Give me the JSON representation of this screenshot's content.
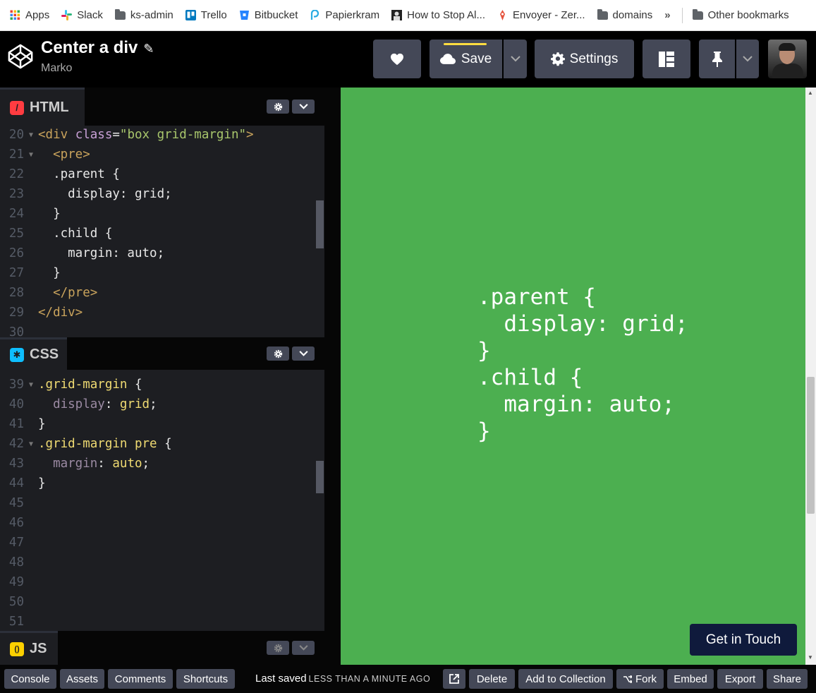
{
  "bookmarks": [
    {
      "label": "Apps",
      "icon": "apps-grid-icon",
      "color": "#ea4335"
    },
    {
      "label": "Slack",
      "icon": "slack-icon",
      "color": "#e01e5a"
    },
    {
      "label": "ks-admin",
      "icon": "folder-icon",
      "color": "#5f6368"
    },
    {
      "label": "Trello",
      "icon": "trello-icon",
      "color": "#0079bf"
    },
    {
      "label": "Bitbucket",
      "icon": "bitbucket-icon",
      "color": "#2684ff"
    },
    {
      "label": "Papierkram",
      "icon": "papierkram-icon",
      "color": "#29abe2"
    },
    {
      "label": "How to Stop Al...",
      "icon": "page-favicon",
      "color": "#222222"
    },
    {
      "label": "Envoyer - Zer...",
      "icon": "envoyer-icon",
      "color": "#e5533d"
    },
    {
      "label": "domains",
      "icon": "folder-icon",
      "color": "#5f6368"
    }
  ],
  "bookmarks_overflow": "»",
  "bookmarks_other": "Other bookmarks",
  "header": {
    "title": "Center a div",
    "owner": "Marko",
    "save_label": "Save",
    "settings_label": "Settings"
  },
  "panels": {
    "html": {
      "label": "HTML",
      "icon_color": "#ff3c41",
      "icon_glyph": "/"
    },
    "css": {
      "label": "CSS",
      "icon_color": "#0ebeff",
      "icon_glyph": "✱"
    },
    "js": {
      "label": "JS",
      "icon_color": "#fcd000",
      "icon_glyph": "()"
    }
  },
  "html_code": [
    {
      "n": "20",
      "fold": true,
      "tokens": [
        {
          "t": "<div ",
          "c": "t-tag"
        },
        {
          "t": "class",
          "c": "t-attr"
        },
        {
          "t": "=",
          "c": "t-p"
        },
        {
          "t": "\"box grid-margin\"",
          "c": "t-str"
        },
        {
          "t": ">",
          "c": "t-tag"
        }
      ]
    },
    {
      "n": "21",
      "fold": true,
      "tokens": [
        {
          "t": "  <pre>",
          "c": "t-tag"
        }
      ]
    },
    {
      "n": "22",
      "fold": false,
      "tokens": [
        {
          "t": "  .parent {",
          "c": "t-p"
        }
      ]
    },
    {
      "n": "23",
      "fold": false,
      "tokens": [
        {
          "t": "    display: grid;",
          "c": "t-p"
        }
      ]
    },
    {
      "n": "24",
      "fold": false,
      "tokens": [
        {
          "t": "  }",
          "c": "t-p"
        }
      ]
    },
    {
      "n": "25",
      "fold": false,
      "tokens": [
        {
          "t": "  .child {",
          "c": "t-p"
        }
      ]
    },
    {
      "n": "26",
      "fold": false,
      "tokens": [
        {
          "t": "    margin: auto;",
          "c": "t-p"
        }
      ]
    },
    {
      "n": "27",
      "fold": false,
      "tokens": [
        {
          "t": "  }",
          "c": "t-p"
        }
      ]
    },
    {
      "n": "28",
      "fold": false,
      "tokens": [
        {
          "t": "  </pre>",
          "c": "t-tag"
        }
      ]
    },
    {
      "n": "29",
      "fold": false,
      "tokens": [
        {
          "t": "</div>",
          "c": "t-tag"
        }
      ]
    },
    {
      "n": "30",
      "fold": false,
      "tokens": []
    }
  ],
  "css_code": [
    {
      "n": "39",
      "fold": true,
      "tokens": [
        {
          "t": ".grid-margin ",
          "c": "t-sel"
        },
        {
          "t": "{",
          "c": "t-p"
        }
      ]
    },
    {
      "n": "40",
      "fold": false,
      "tokens": [
        {
          "t": "  display",
          "c": "t-prop"
        },
        {
          "t": ": ",
          "c": "t-p"
        },
        {
          "t": "grid",
          "c": "t-val"
        },
        {
          "t": ";",
          "c": "t-p"
        }
      ]
    },
    {
      "n": "41",
      "fold": false,
      "tokens": [
        {
          "t": "}",
          "c": "t-p"
        }
      ]
    },
    {
      "n": "42",
      "fold": true,
      "tokens": [
        {
          "t": ".grid-margin pre ",
          "c": "t-sel"
        },
        {
          "t": "{",
          "c": "t-p"
        }
      ]
    },
    {
      "n": "43",
      "fold": false,
      "tokens": [
        {
          "t": "  margin",
          "c": "t-prop"
        },
        {
          "t": ": ",
          "c": "t-p"
        },
        {
          "t": "auto",
          "c": "t-val"
        },
        {
          "t": ";",
          "c": "t-p"
        }
      ]
    },
    {
      "n": "44",
      "fold": false,
      "tokens": [
        {
          "t": "}",
          "c": "t-p"
        }
      ]
    },
    {
      "n": "45",
      "fold": false,
      "tokens": []
    },
    {
      "n": "46",
      "fold": false,
      "tokens": []
    },
    {
      "n": "47",
      "fold": false,
      "tokens": []
    },
    {
      "n": "48",
      "fold": false,
      "tokens": []
    },
    {
      "n": "49",
      "fold": false,
      "tokens": []
    },
    {
      "n": "50",
      "fold": false,
      "tokens": []
    },
    {
      "n": "51",
      "fold": false,
      "tokens": []
    }
  ],
  "preview": {
    "output_text": ".parent {\n  display: grid;\n}\n.child {\n  margin: auto;\n}",
    "background": "#4caf50",
    "cta_label": "Get in Touch"
  },
  "footer": {
    "console": "Console",
    "assets": "Assets",
    "comments": "Comments",
    "shortcuts": "Shortcuts",
    "last_saved": "Last saved",
    "last_saved_when": "LESS THAN A MINUTE AGO",
    "delete": "Delete",
    "add_to_collection": "Add to Collection",
    "fork": "Fork",
    "embed": "Embed",
    "export": "Export",
    "share": "Share"
  }
}
